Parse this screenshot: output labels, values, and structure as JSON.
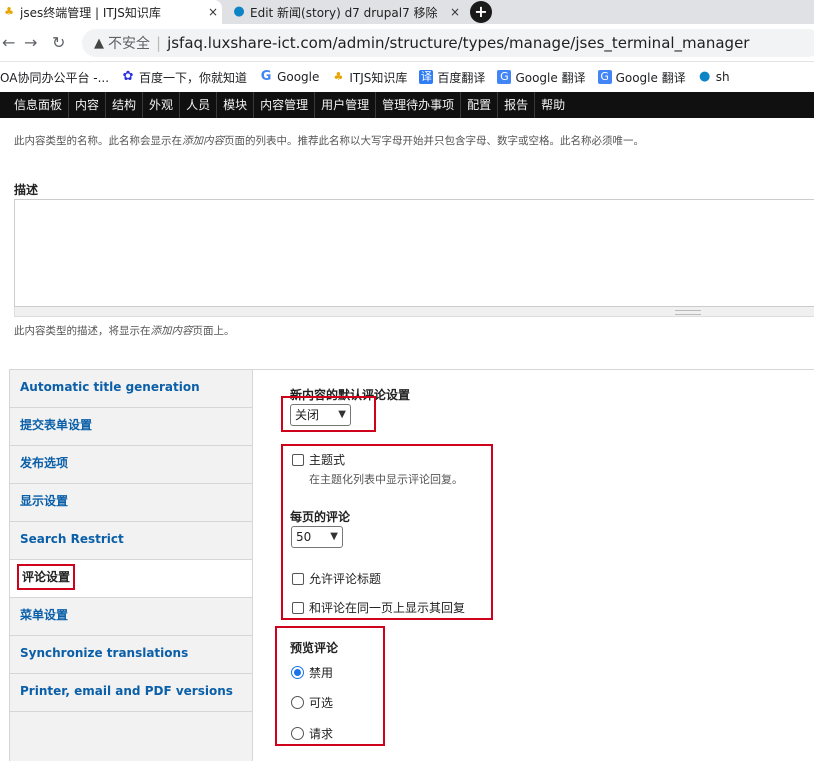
{
  "browser": {
    "tabs": [
      {
        "title": "jses终端管理 | ITJS知识库",
        "close": "×",
        "active": true
      },
      {
        "title": "Edit 新闻(story) d7 drupal7 移除",
        "close": "×",
        "active": false
      }
    ],
    "new_tab": "+",
    "address": {
      "security_label": "不安全",
      "separator": "|",
      "url": "jsfaq.luxshare-ict.com/admin/structure/types/manage/jses_terminal_manager"
    },
    "bookmarks": [
      {
        "label": "OA协同办公平台 -...",
        "icon": "oa-icon"
      },
      {
        "label": "百度一下，你就知道",
        "icon": "baidu-icon"
      },
      {
        "label": "Google",
        "icon": "google-icon"
      },
      {
        "label": "ITJS知识库",
        "icon": "leaf-icon"
      },
      {
        "label": "百度翻译",
        "icon": "translate-icon"
      },
      {
        "label": "Google 翻译",
        "icon": "google-translate-icon"
      },
      {
        "label": "Google 翻译",
        "icon": "google-translate-icon"
      },
      {
        "label": "sh",
        "icon": "drupal-icon"
      }
    ]
  },
  "toolbar": {
    "items": [
      "信息面板",
      "内容",
      "结构",
      "外观",
      "人员",
      "模块",
      "内容管理",
      "用户管理",
      "管理待办事项",
      "配置",
      "报告",
      "帮助"
    ]
  },
  "form": {
    "name_description_prefix": "此内容类型的名称。此名称会显示在",
    "name_description_em": "添加内容",
    "name_description_suffix": "页面的列表中。推荐此名称以大写字母开始并只包含字母、数字或空格。此名称必须唯一。",
    "desc_label": "描述",
    "desc_value": "",
    "desc_help_prefix": "此内容类型的描述，将显示在",
    "desc_help_em": "添加内容",
    "desc_help_suffix": "页面上。"
  },
  "vertical_tabs": [
    {
      "label": "Automatic title generation",
      "selected": false
    },
    {
      "label": "提交表单设置",
      "selected": false
    },
    {
      "label": "发布选项",
      "selected": false
    },
    {
      "label": "显示设置",
      "selected": false
    },
    {
      "label": "Search Restrict",
      "selected": false
    },
    {
      "label": "评论设置",
      "selected": true
    },
    {
      "label": "菜单设置",
      "selected": false
    },
    {
      "label": "Synchronize translations",
      "selected": false
    },
    {
      "label": "Printer, email and PDF versions",
      "selected": false
    }
  ],
  "comments": {
    "default_label": "新内容的默认评论设置",
    "default_value": "关闭",
    "threading_label": "主题式",
    "threading_checked": false,
    "threading_desc": "在主题化列表中显示评论回复。",
    "per_page_label": "每页的评论",
    "per_page_value": "50",
    "allow_title_label": "允许评论标题",
    "allow_title_checked": false,
    "same_page_label": "和评论在同一页上显示其回复",
    "same_page_checked": false,
    "preview_label": "预览评论",
    "preview_options": [
      {
        "label": "禁用",
        "selected": true
      },
      {
        "label": "可选",
        "selected": false
      },
      {
        "label": "请求",
        "selected": false
      }
    ]
  },
  "colors": {
    "link": "#0a5fa8",
    "highlight": "#d0021b",
    "toolbar_bg": "#101010"
  }
}
